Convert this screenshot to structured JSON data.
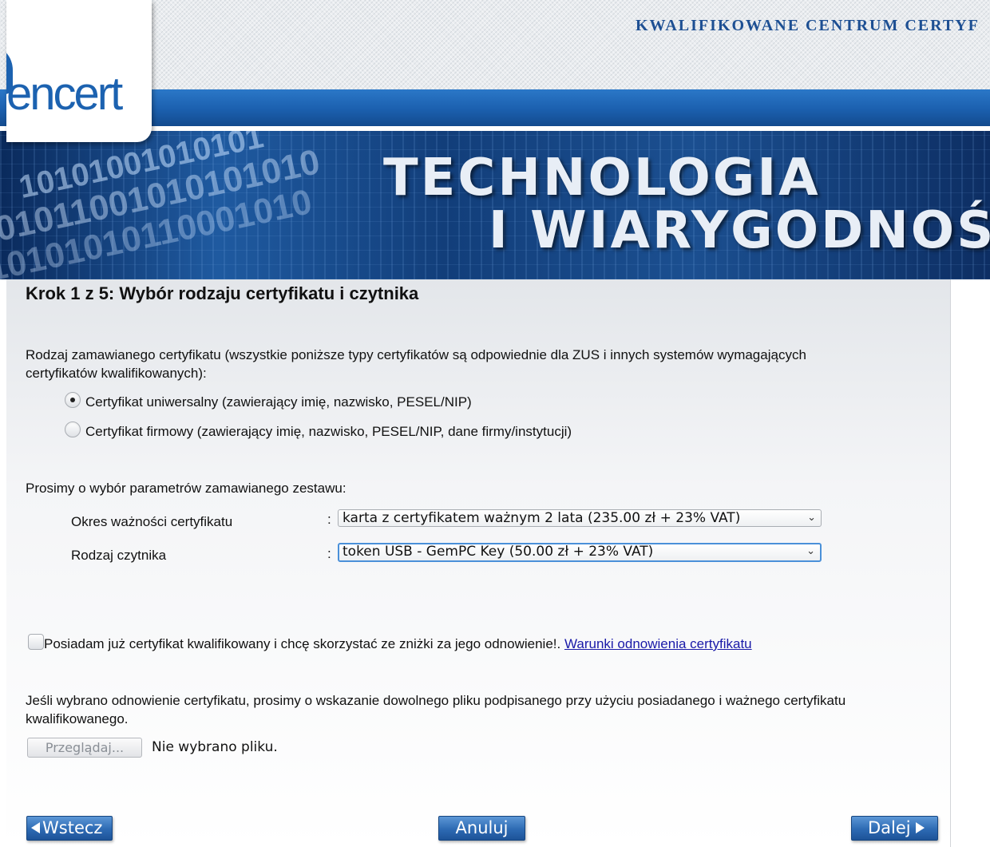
{
  "header": {
    "title": "KWALIFIKOWANE CENTRUM CERTYF",
    "logo_text": "encert",
    "banner_line1": "TECHNOLOGIA",
    "banner_line2": "I WIARYGODNOŚ",
    "binary_rows": [
      "10101001010101",
      "01011001010101010",
      "10101010110001010"
    ]
  },
  "step": {
    "title": "Krok 1 z 5: Wybór rodzaju certyfikatu i czytnika"
  },
  "certificate_type": {
    "label_line1": "Rodzaj zamawianego certyfikatu (wszystkie poniższe typy certyfikatów są odpowiednie dla ZUS i innych systemów wymagających",
    "label_line2": "certyfikatów kwalifikowanych):",
    "options": [
      {
        "label": "Certyfikat uniwersalny (zawierający imię, nazwisko, PESEL/NIP)",
        "selected": true
      },
      {
        "label": "Certyfikat firmowy (zawierający imię, nazwisko, PESEL/NIP, dane firmy/instytucji)",
        "selected": false
      }
    ]
  },
  "parameters": {
    "intro": "Prosimy o wybór parametrów zamawianego zestawu:",
    "separator": ":",
    "validity": {
      "label": "Okres ważności certyfikatu",
      "value": "karta z certyfikatem ważnym 2 lata (235.00 zł + 23% VAT)"
    },
    "reader": {
      "label": "Rodzaj czytnika",
      "value": "token USB - GemPC Key (50.00 zł + 23% VAT)"
    }
  },
  "renewal": {
    "checkbox_label": "Posiadam już certyfikat kwalifikowany i chcę skorzystać ze zniżki za jego odnowienie!.",
    "link": "Warunki odnowienia certyfikatu",
    "checked": false,
    "note_line1": "Jeśli wybrano odnowienie certyfikatu, prosimy o wskazanie dowolnego pliku podpisanego przy użyciu posiadanego i ważnego certyfikatu",
    "note_line2": "kwalifikowanego.",
    "browse_button": "Przeglądaj...",
    "no_file": "Nie wybrano pliku."
  },
  "navigation": {
    "back": "Wstecz",
    "cancel": "Anuluj",
    "next": "Dalej"
  },
  "colors": {
    "brand_blue": "#1c62b0",
    "button_blue": "#2d6ab3",
    "link": "#1a1aa8"
  }
}
